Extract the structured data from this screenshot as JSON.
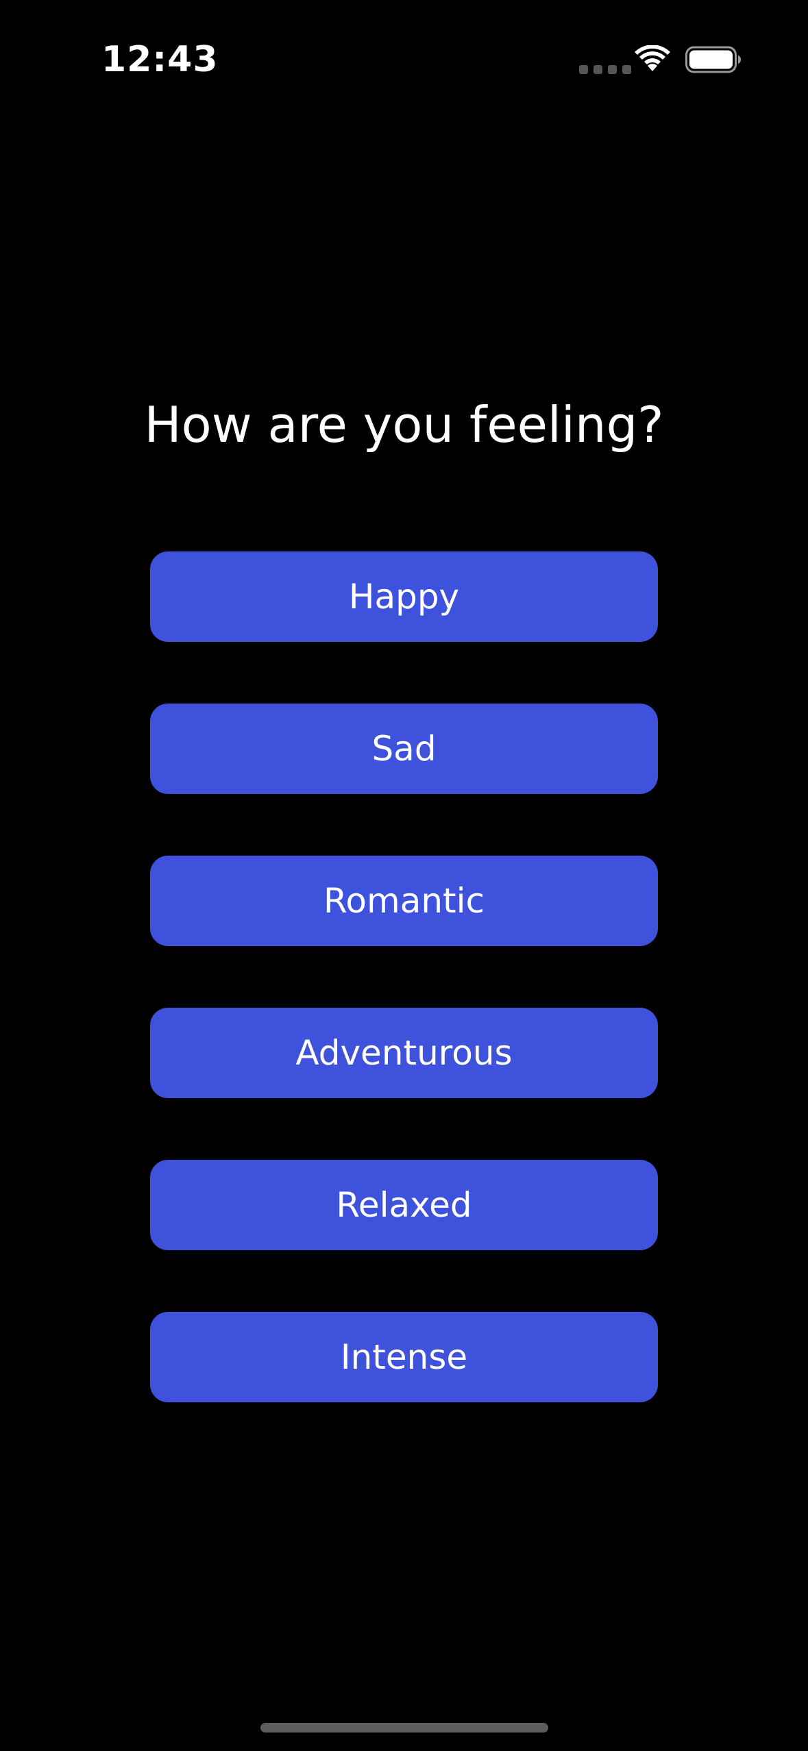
{
  "status_bar": {
    "time": "12:43",
    "icons": [
      "cellular-signal-icon",
      "wifi-icon",
      "battery-icon"
    ]
  },
  "main": {
    "title": "How are you feeling?",
    "moods": [
      {
        "label": "Happy"
      },
      {
        "label": "Sad"
      },
      {
        "label": "Romantic"
      },
      {
        "label": "Adventurous"
      },
      {
        "label": "Relaxed"
      },
      {
        "label": "Intense"
      }
    ]
  },
  "colors": {
    "background": "#000000",
    "button": "#3f52dc",
    "text": "#ffffff"
  }
}
